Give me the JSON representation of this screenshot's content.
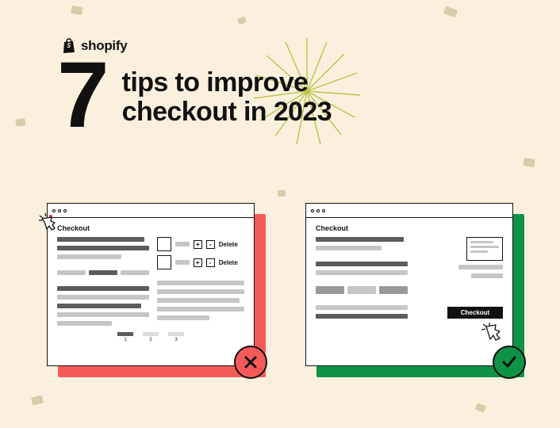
{
  "brand": {
    "name": "shopify"
  },
  "title": {
    "bignum": "7",
    "line1": "tips to improve",
    "line2": "checkout in 2023"
  },
  "panel_bad": {
    "heading": "Checkout",
    "cart": {
      "plus": "+",
      "minus": "-",
      "delete": "Delete"
    },
    "pager": [
      "1",
      "2",
      "3"
    ]
  },
  "panel_good": {
    "heading": "Checkout",
    "cta": "Checkout"
  }
}
